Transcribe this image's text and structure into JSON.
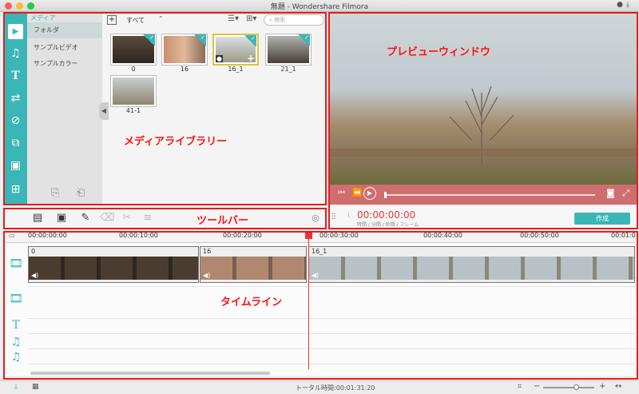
{
  "window": {
    "title": "無題 - Wondershare Filmora"
  },
  "media_library": {
    "header": "メディア",
    "folders": [
      "フォルダ",
      "サンプルビデオ",
      "サンプルカラー"
    ],
    "filter_label": "すべて",
    "search_placeholder": "検索",
    "thumbnails": [
      {
        "label": "0",
        "checked": true
      },
      {
        "label": "16",
        "checked": true
      },
      {
        "label": "16_1",
        "checked": true
      },
      {
        "label": "21_1",
        "checked": true
      },
      {
        "label": "41-1",
        "checked": false
      }
    ]
  },
  "preview": {
    "timecode": "00:00:00:00",
    "timecode_units": "時間 / 分間 / 秒間 / フレーム",
    "export_label": "作成"
  },
  "timeline": {
    "ruler": [
      "00:00:00:00",
      "00:00:10:00",
      "00:00:20:00",
      "00:00:30:00",
      "00:00:40:00",
      "00:00:50:00",
      "00:01:0"
    ],
    "clips": [
      "0",
      "16",
      "16_1"
    ]
  },
  "annotations": {
    "media": "メディアライブラリー",
    "preview": "プレビューウィンドウ",
    "toolbar": "ツールバー",
    "timeline": "タイムライン"
  },
  "status": {
    "total_time": "トータル時間:00:01:31:20"
  },
  "colors": {
    "accent": "#3bb6b6",
    "annotation": "#e41d1d",
    "preview_bar": "#cf6e6e"
  }
}
